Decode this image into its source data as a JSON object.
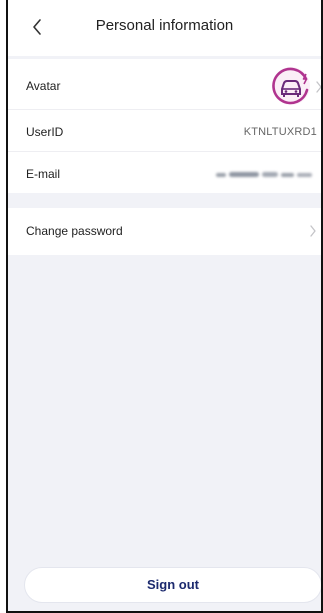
{
  "header": {
    "title": "Personal information",
    "back_icon": "chevron-left-icon"
  },
  "profile": {
    "avatar_label": "Avatar",
    "avatar_icon": "car-charging-icon",
    "avatar_color": "#b0348f",
    "userid_label": "UserID",
    "userid_value": "KTNLTUXRD1",
    "email_label": "E-mail"
  },
  "security": {
    "change_password_label": "Change password"
  },
  "footer": {
    "sign_out_label": "Sign out",
    "sign_out_color": "#1c2a6e"
  }
}
